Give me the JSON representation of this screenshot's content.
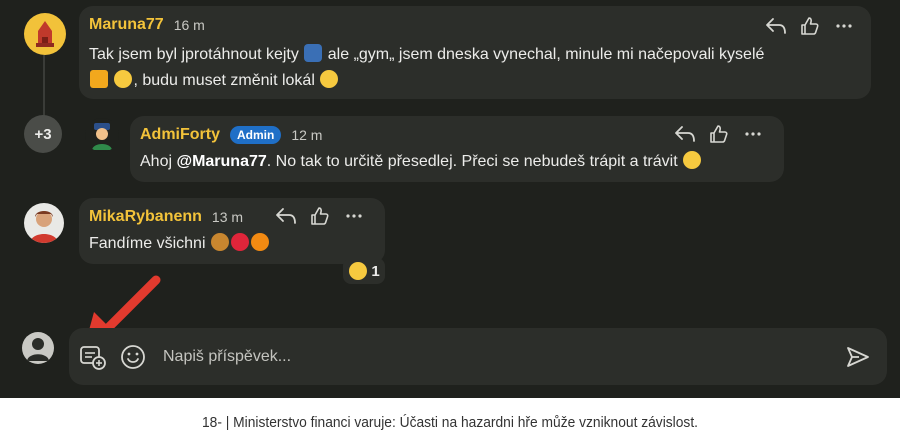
{
  "comments": [
    {
      "author": "Maruna77",
      "time": "16 m",
      "text_parts": [
        "Tak jsem byl jprotáhnout kejty ",
        " ale „gym„ jsem dneska vynechal, minule mi načepovali kyselé",
        ", budu muset změnit lokál "
      ],
      "emoji_icons": [
        "runner-emoji",
        "beer-emoji",
        "rolling-eyes-emoji",
        "grinning-emoji"
      ]
    },
    {
      "author": "AdmiForty",
      "badge": "Admin",
      "time": "12 m",
      "greeting": "Ahoj ",
      "mention": "@Maruna77",
      "text": ". No tak to určitě přesedlej. Přeci se nebudeš trápit a trávit ",
      "emoji_icons": [
        "rofl-emoji"
      ]
    },
    {
      "author": "MikaRybanenn",
      "time": "13 m",
      "text": "Fandíme všichni ",
      "emoji_icons": [
        "lion-emoji",
        "red-circle-emoji",
        "orange-circle-emoji"
      ],
      "reaction": {
        "icon": "joy-emoji",
        "count": "1"
      }
    }
  ],
  "hidden_replies_label": "+3",
  "composer": {
    "placeholder": "Napiš příspěvek...",
    "icons": [
      "user-avatar-icon",
      "add-attachment-icon",
      "emoji-icon",
      "send-icon"
    ]
  },
  "colors": {
    "background": "#1f211d",
    "bubble": "#2c2e2a",
    "author": "#f3c33a",
    "admin_badge": "#1f6fc7",
    "annotation_arrow": "#e23a2e"
  },
  "caption": "18- | Ministerstvo financi varuje: Účasti na hazardni hře může vzniknout závislost."
}
